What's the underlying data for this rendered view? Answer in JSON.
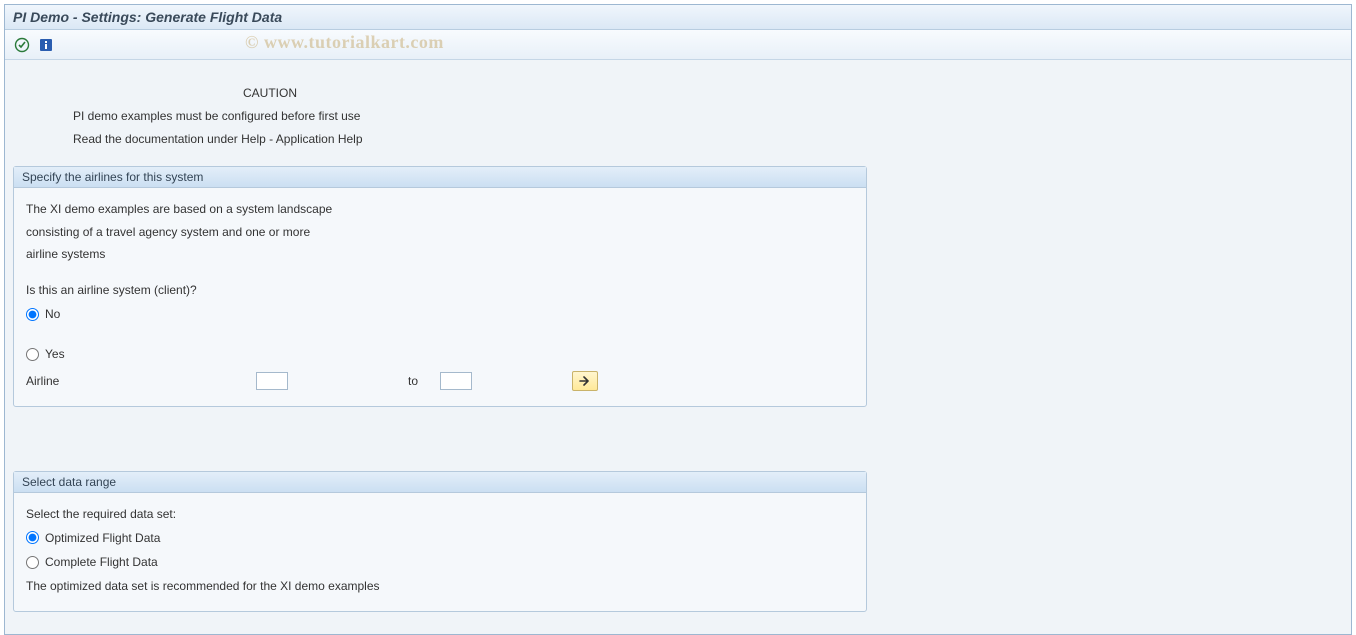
{
  "window": {
    "title": "PI Demo - Settings: Generate Flight Data"
  },
  "watermark": "© www.tutorialkart.com",
  "caution": {
    "title": "CAUTION",
    "line1": "PI demo examples must be configured before first use",
    "line2": "Read the documentation under Help - Application Help"
  },
  "group1": {
    "header": "Specify the airlines for this system",
    "desc_line1": "The XI demo examples are based on a system landscape",
    "desc_line2": "consisting of a travel agency system and one or more",
    "desc_line3": "airline systems",
    "question": "Is this an airline system (client)?",
    "radio_no": "No",
    "radio_yes": "Yes",
    "airline_label": "Airline",
    "airline_from": "",
    "to_label": "to",
    "airline_to": ""
  },
  "group2": {
    "header": "Select data range",
    "prompt": "Select the required data set:",
    "radio_opt": "Optimized Flight Data",
    "radio_comp": "Complete Flight Data",
    "hint": "The optimized data set is recommended for the XI demo examples"
  }
}
